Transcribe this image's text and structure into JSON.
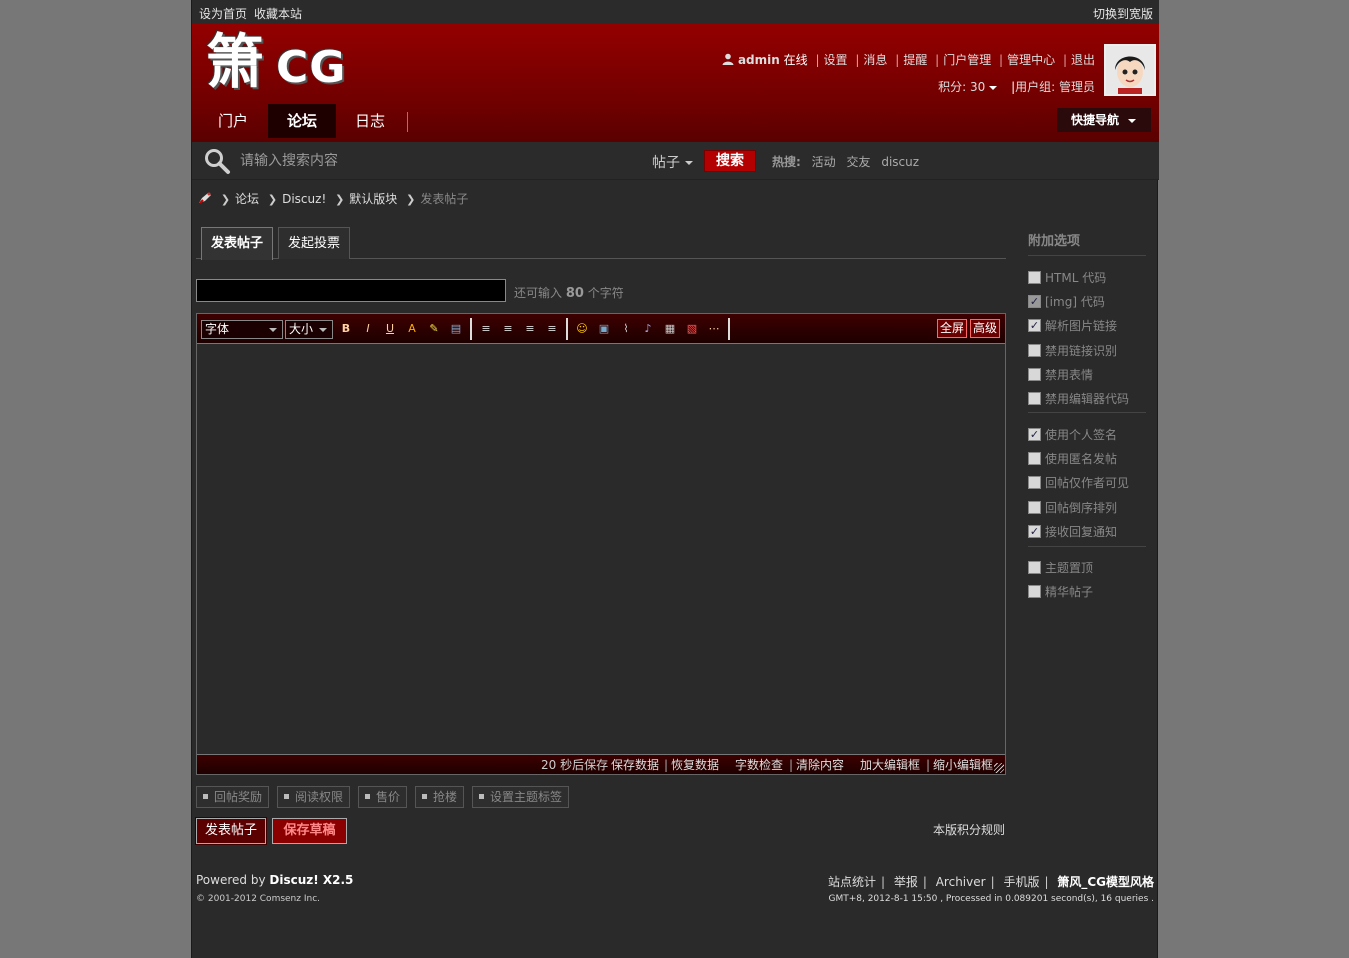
{
  "topbar": {
    "set_home": "设为首页",
    "bookmark": "收藏本站",
    "switch_width": "切换到宽版"
  },
  "header": {
    "logo_char": "箫",
    "logo_text": "CG",
    "user": {
      "name": "admin",
      "status": "在线",
      "links": [
        "设置",
        "消息",
        "提醒",
        "门户管理",
        "管理中心",
        "退出"
      ],
      "credits_label": "积分: 30",
      "group_label": "用户组: 管理员"
    },
    "nav": [
      "门户",
      "论坛",
      "日志"
    ],
    "quick_nav": "快捷导航"
  },
  "search": {
    "placeholder": "请输入搜索内容",
    "type": "帖子",
    "button": "搜索",
    "hot_label": "热搜:",
    "hot_words": [
      "活动",
      "交友",
      "discuz"
    ]
  },
  "breadcrumb": {
    "items": [
      "论坛",
      "Discuz!",
      "默认版块"
    ],
    "current": "发表帖子"
  },
  "tabs": [
    "发表帖子",
    "发起投票"
  ],
  "title_hint": {
    "pre": "还可输入",
    "count": "80",
    "post": "个字符"
  },
  "editor": {
    "font_select": "字体",
    "size_select": "大小",
    "fullscreen": "全屏",
    "advanced": "高级",
    "status": {
      "autosave": "20 秒后保存",
      "save": "保存数据",
      "restore": "恢复数据",
      "check": "字数检查",
      "clear": "清除内容",
      "enlarge": "加大编辑框",
      "shrink": "缩小编辑框"
    }
  },
  "extras": [
    "回帖奖励",
    "阅读权限",
    "售价",
    "抢楼",
    "设置主题标签"
  ],
  "actions": {
    "submit": "发表帖子",
    "draft": "保存草稿",
    "rules": "本版积分规则"
  },
  "sidebar": {
    "title": "附加选项",
    "group1": [
      {
        "label": "HTML 代码",
        "checked": false,
        "disabled": false
      },
      {
        "label": "[img] 代码",
        "checked": true,
        "disabled": true
      },
      {
        "label": "解析图片链接",
        "checked": true,
        "disabled": false
      },
      {
        "label": "禁用链接识别",
        "checked": false,
        "disabled": false
      },
      {
        "label": "禁用表情",
        "checked": false,
        "disabled": false
      },
      {
        "label": "禁用编辑器代码",
        "checked": false,
        "disabled": false
      }
    ],
    "group2": [
      {
        "label": "使用个人签名",
        "checked": true,
        "disabled": false
      },
      {
        "label": "使用匿名发帖",
        "checked": false,
        "disabled": false
      },
      {
        "label": "回帖仅作者可见",
        "checked": false,
        "disabled": false
      },
      {
        "label": "回帖倒序排列",
        "checked": false,
        "disabled": false
      },
      {
        "label": "接收回复通知",
        "checked": true,
        "disabled": false
      }
    ],
    "group3": [
      {
        "label": "主题置顶",
        "checked": false,
        "disabled": false
      },
      {
        "label": "精华帖子",
        "checked": false,
        "disabled": false
      }
    ]
  },
  "footer": {
    "powered_pre": "Powered by",
    "product": "Discuz! X2.5",
    "copyright": "© 2001-2012 Comsenz Inc.",
    "links": [
      "站点统计",
      "举报",
      "Archiver",
      "手机版"
    ],
    "style_name": "箫风_CG模型风格",
    "info": "GMT+8, 2012-8-1 15:50 , Processed in 0.089201 second(s), 16 queries ."
  },
  "colors": {
    "brand_red": "#8b0000",
    "page_bg": "#2a2a2a",
    "outer_bg": "#777777"
  }
}
